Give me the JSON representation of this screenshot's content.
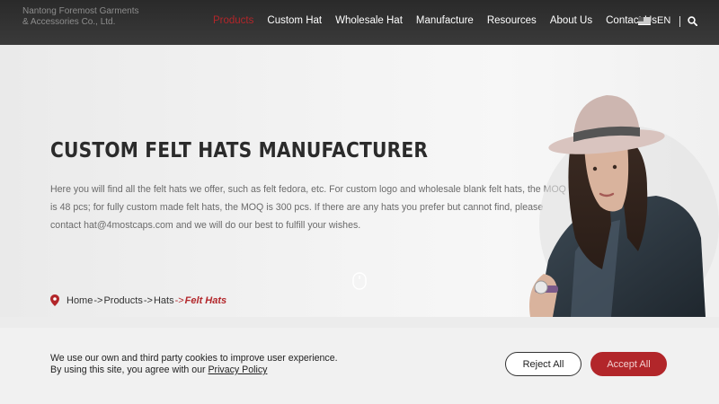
{
  "header": {
    "company_name": "Nantong Foremost Garments & Accessories Co., Ltd.",
    "nav": [
      {
        "label": "Products",
        "active": true
      },
      {
        "label": "Custom Hat",
        "active": false
      },
      {
        "label": "Wholesale Hat",
        "active": false
      },
      {
        "label": "Manufacture",
        "active": false
      },
      {
        "label": "Resources",
        "active": false
      },
      {
        "label": "About Us",
        "active": false
      },
      {
        "label": "Contact Us",
        "active": false
      }
    ],
    "language": "EN",
    "language_icon": "us-flag-icon",
    "search_icon": "search-icon"
  },
  "hero": {
    "title": "CUSTOM FELT HATS MANUFACTURER",
    "description": "Here you will find all the felt hats we offer, such as felt fedora, etc. For custom logo and wholesale blank felt hats, the MOQ is 48 pcs; for fully custom made felt hats, the MOQ is 300 pcs. If there are any hats you prefer but cannot find, please contact hat@4mostcaps.com and we will do our best to fulfill your wishes.",
    "scroll_icon": "mouse-scroll-icon"
  },
  "breadcrumb": {
    "items": [
      "Home",
      "Products",
      "Hats"
    ],
    "separator": "->",
    "current": "Felt Hats",
    "current_prefix": "->"
  },
  "cookie": {
    "line1": "We use our own and third party cookies to improve user experience.",
    "line2_prefix": "By using this site, you agree with our ",
    "policy_link": "Privacy Policy",
    "reject_label": "Reject All",
    "accept_label": "Accept All"
  },
  "colors": {
    "accent": "#b2262a",
    "header_bg": "#333333"
  }
}
